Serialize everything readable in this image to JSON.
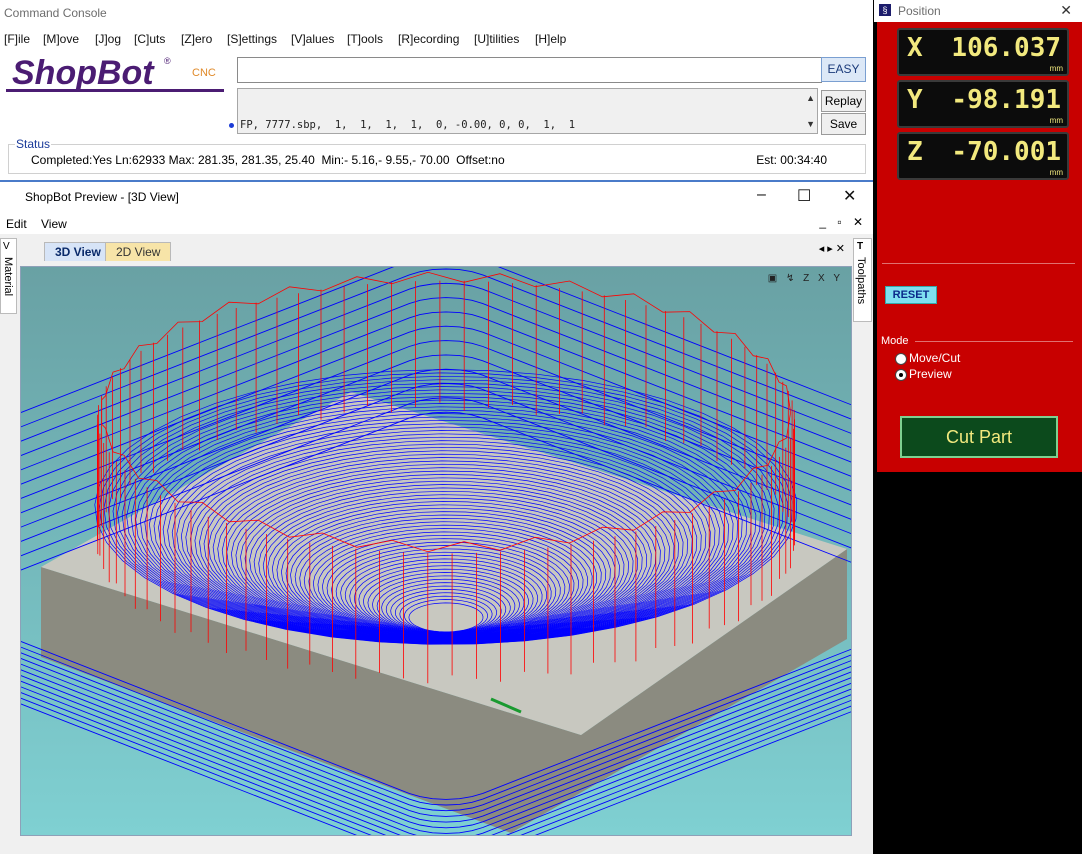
{
  "console": {
    "title": "Command Console",
    "menu": [
      "[F]ile",
      "[M]ove",
      "[J]og",
      "[C]uts",
      "[Z]ero",
      "[S]ettings",
      "[V]alues",
      "[T]ools",
      "[R]ecording",
      "[U]tilities",
      "[H]elp"
    ],
    "logo_text": "ShopBot",
    "logo_sub": "CNC",
    "logo_mark": "®",
    "command_value": "",
    "easy_label": "EASY",
    "history_line": "FP, 7777.sbp,  1,  1,  1,  1,  0, -0.00, 0, 0,  1,  1",
    "replay_label": "Replay",
    "save_label": "Save",
    "status_label": "Status",
    "status_text": "Completed:Yes Ln:62933 Max: 281.35, 281.35, 25.40  Min:- 5.16,- 9.55,- 70.00  Offset:no",
    "est_text": "Est: 00:34:40"
  },
  "preview": {
    "title": "ShopBot Preview - [3D View]",
    "menu": [
      "Edit",
      "View"
    ],
    "tabs": [
      "3D View",
      "2D View"
    ],
    "left_panel": "Material",
    "right_panel": "Toolpaths",
    "view_icons": [
      "zoom-extents-icon",
      "iso-view-icon",
      "top-view-icon",
      "front-view-icon",
      "side-view-icon"
    ]
  },
  "position": {
    "title": "Position",
    "x_axis": "X",
    "x_value": "106.037",
    "y_axis": "Y",
    "y_value": "-98.191",
    "z_axis": "Z",
    "z_value": "-70.001",
    "unit": "mm",
    "reset_label": "RESET",
    "mode_label": "Mode",
    "mode_options": [
      "Move/Cut",
      "Preview"
    ],
    "mode_selected": "Preview",
    "cut_part_label": "Cut Part"
  },
  "colors": {
    "panel_red": "#c80000",
    "readout_yellow": "#f2e97e",
    "viewport_bg": "#6aa9ac",
    "toolpath_blue": "#0000ff",
    "toolpath_red": "#ff0000"
  }
}
